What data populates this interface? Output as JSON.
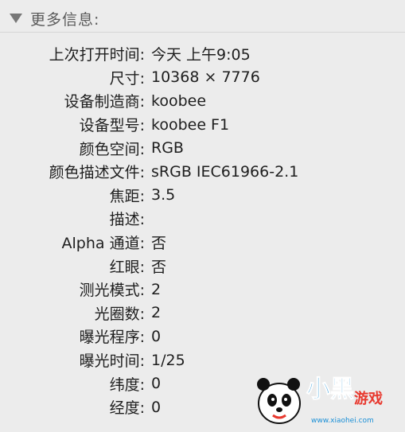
{
  "section": {
    "title": "更多信息:"
  },
  "rows": [
    {
      "label": "上次打开时间:",
      "value": "今天 上午9:05"
    },
    {
      "label": "尺寸:",
      "value": "10368 × 7776"
    },
    {
      "label": "设备制造商:",
      "value": "koobee"
    },
    {
      "label": "设备型号:",
      "value": "koobee F1"
    },
    {
      "label": "颜色空间:",
      "value": "RGB"
    },
    {
      "label": "颜色描述文件:",
      "value": "sRGB IEC61966-2.1"
    },
    {
      "label": "焦距:",
      "value": "3.5"
    },
    {
      "label": "描述:",
      "value": ""
    },
    {
      "label": "Alpha 通道:",
      "value": "否"
    },
    {
      "label": "红眼:",
      "value": "否"
    },
    {
      "label": "测光模式:",
      "value": "2"
    },
    {
      "label": "光圈数:",
      "value": "2"
    },
    {
      "label": "曝光程序:",
      "value": "0"
    },
    {
      "label": "曝光时间:",
      "value": "1/25"
    },
    {
      "label": "纬度:",
      "value": "0"
    },
    {
      "label": "经度:",
      "value": "0"
    }
  ],
  "watermark": {
    "text": "小黑游戏",
    "url": "www.xiaohei.com",
    "colors": {
      "primary": "#1a8fd6",
      "accent": "#e8392f",
      "panda": "#111111"
    }
  },
  "colors": {
    "background": "#ececec",
    "text": "#1e1e1e",
    "header_text": "#5a5a5a",
    "disclosure": "#777777"
  },
  "icons": {
    "disclosure": "disclosure-triangle-down-icon",
    "watermark": "panda-mascot-icon"
  }
}
